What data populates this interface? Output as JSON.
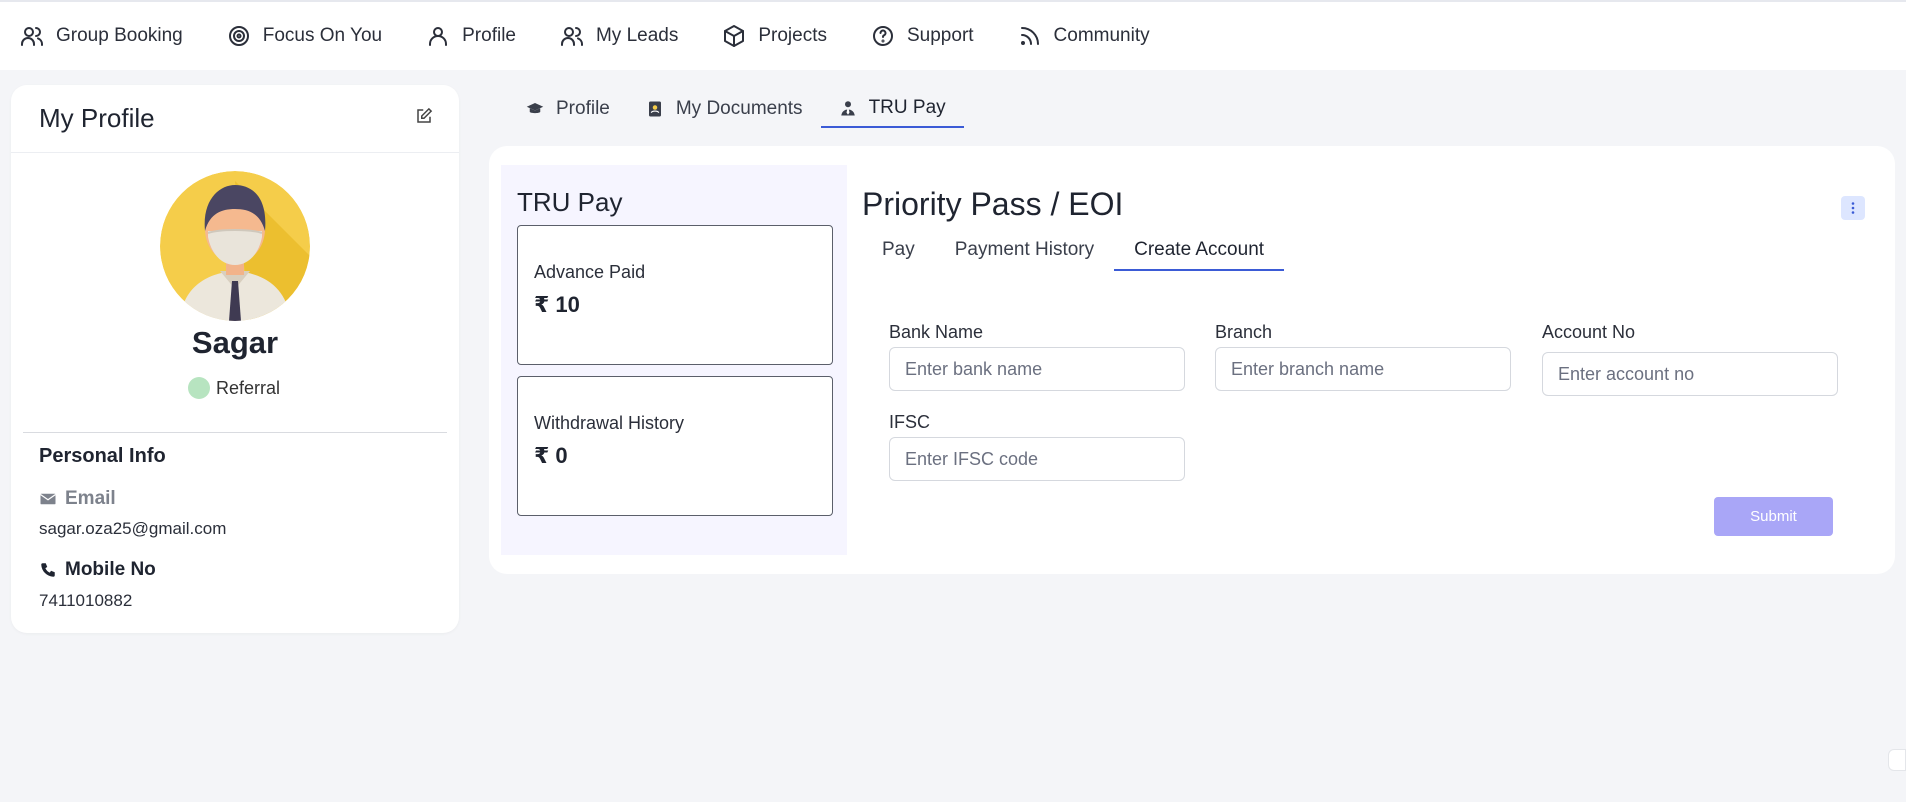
{
  "topnav": {
    "items": [
      {
        "label": "Group Booking",
        "icon": "users-icon"
      },
      {
        "label": "Focus On You",
        "icon": "target-icon"
      },
      {
        "label": "Profile",
        "icon": "user-icon"
      },
      {
        "label": "My Leads",
        "icon": "users-icon"
      },
      {
        "label": "Projects",
        "icon": "box-icon"
      },
      {
        "label": "Support",
        "icon": "help-circle-icon"
      },
      {
        "label": "Community",
        "icon": "rss-icon"
      }
    ]
  },
  "profile": {
    "title": "My Profile",
    "name": "Sagar",
    "role": "Referral",
    "role_color": "#b7e4c0",
    "section_title": "Personal Info",
    "email_label": "Email",
    "email": "sagar.oza25@gmail.com",
    "mobile_label": "Mobile No",
    "mobile": "7411010882"
  },
  "page_tabs": [
    {
      "label": "Profile",
      "icon": "graduation-cap-icon",
      "active": false
    },
    {
      "label": "My Documents",
      "icon": "address-book-icon",
      "active": false
    },
    {
      "label": "TRU Pay",
      "icon": "user-tie-icon",
      "active": true
    }
  ],
  "trupay": {
    "title": "TRU Pay",
    "advance_label": "Advance Paid",
    "advance_value": "₹ 10",
    "withdrawal_label": "Withdrawal History",
    "withdrawal_value": "₹ 0"
  },
  "priority": {
    "title": "Priority Pass / EOI",
    "tabs": [
      {
        "label": "Pay",
        "active": false
      },
      {
        "label": "Payment History",
        "active": false
      },
      {
        "label": "Create Account",
        "active": true
      }
    ],
    "form": {
      "bank_label": "Bank Name",
      "bank_placeholder": "Enter bank name",
      "branch_label": "Branch",
      "branch_placeholder": "Enter branch name",
      "account_label": "Account No",
      "account_placeholder": "Enter account no",
      "ifsc_label": "IFSC",
      "ifsc_placeholder": "Enter IFSC code",
      "submit_label": "Submit"
    }
  },
  "colors": {
    "accent": "#3b5bd6",
    "submit": "#a9a6f7",
    "panel": "#f6f5ff"
  }
}
